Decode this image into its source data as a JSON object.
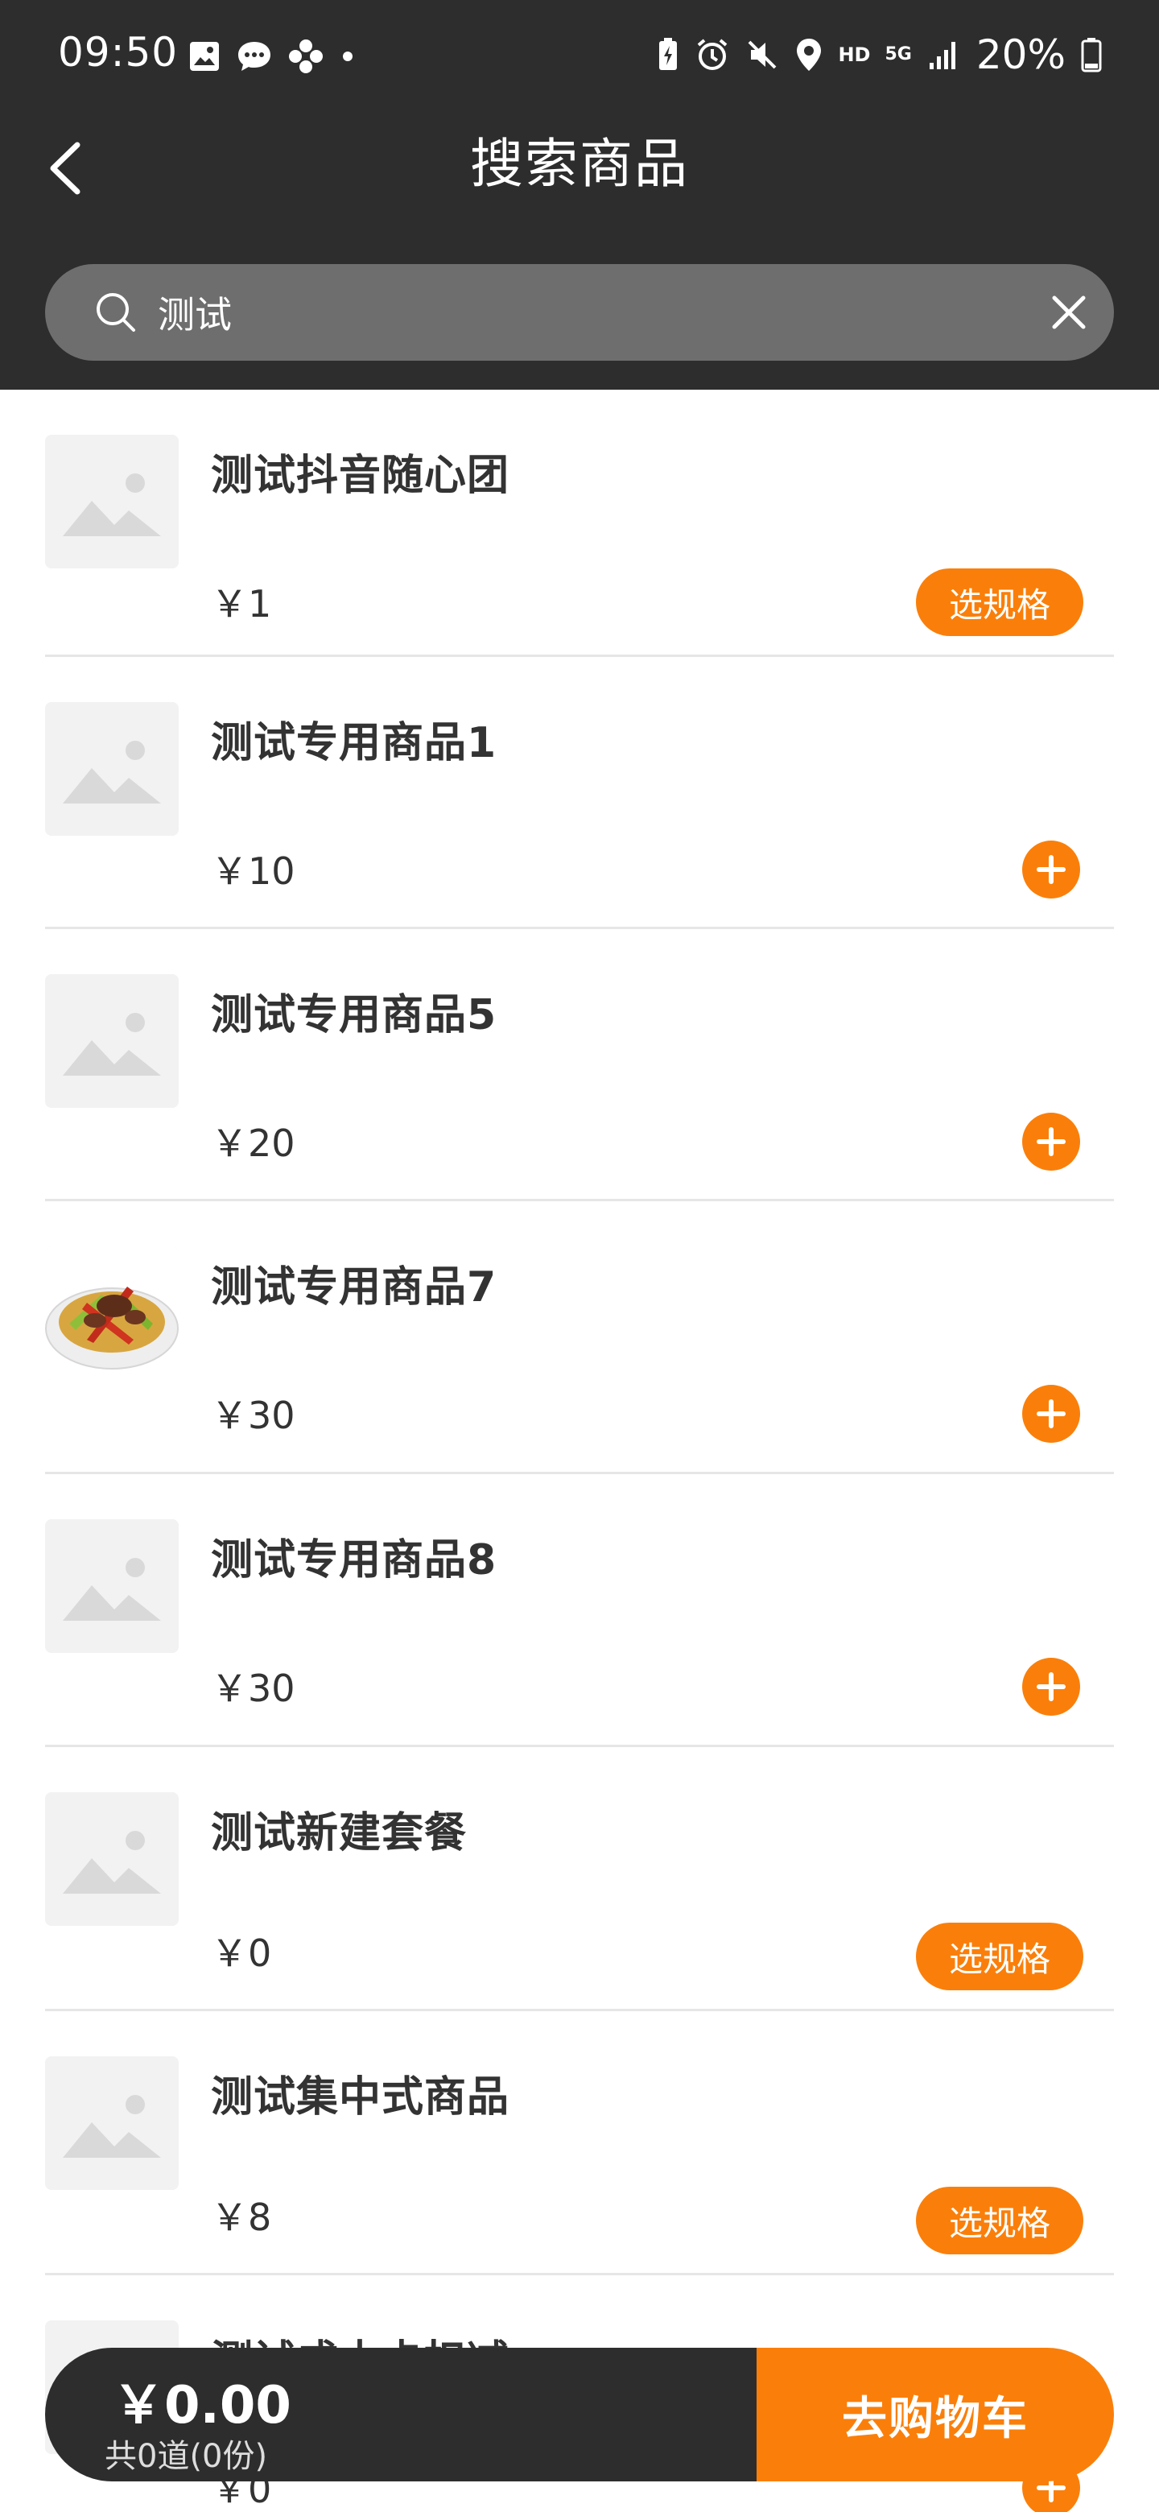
{
  "status_bar": {
    "time": "09:50",
    "network": "HD",
    "signal_label": "5G",
    "battery": "20%"
  },
  "header": {
    "title": "搜索商品"
  },
  "search": {
    "value": "测试"
  },
  "colors": {
    "header_bg": "#2d2d2d",
    "accent": "#fa7f0a"
  },
  "items": [
    {
      "name": "测试抖音随心团",
      "price": "￥1",
      "action": "spec",
      "spec_label": "选规格",
      "image": "placeholder"
    },
    {
      "name": "测试专用商品1",
      "price": "￥10",
      "action": "add",
      "image": "placeholder"
    },
    {
      "name": "测试专用商品5",
      "price": "￥20",
      "action": "add",
      "image": "placeholder"
    },
    {
      "name": "测试专用商品7",
      "price": "￥30",
      "action": "add",
      "image": "food-photo"
    },
    {
      "name": "测试专用商品8",
      "price": "￥30",
      "action": "add",
      "image": "placeholder"
    },
    {
      "name": "测试新建套餐",
      "price": "￥0",
      "action": "spec",
      "spec_label": "选规格",
      "image": "placeholder"
    },
    {
      "name": "测试集中式商品",
      "price": "￥8",
      "action": "spec",
      "spec_label": "选规格",
      "image": "placeholder"
    },
    {
      "name": "测试成本卡扣减",
      "price": "￥0",
      "action": "add",
      "image": "placeholder"
    }
  ],
  "cart": {
    "total": "￥0.00",
    "count": "共0道(0份)",
    "checkout_label": "去购物车"
  }
}
